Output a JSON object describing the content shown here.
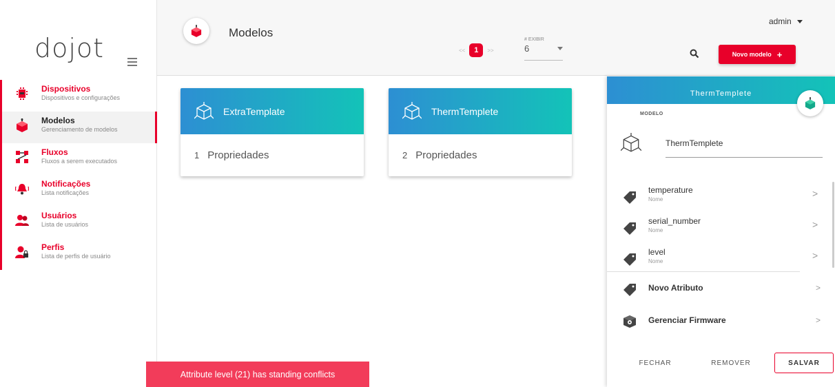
{
  "app": {
    "logo": "dojot"
  },
  "sidebar": {
    "items": [
      {
        "title": "Dispositivos",
        "subtitle": "Dispositivos e configurações",
        "icon": "chip-icon"
      },
      {
        "title": "Modelos",
        "subtitle": "Gerenciamento de modelos",
        "icon": "cube-icon"
      },
      {
        "title": "Fluxos",
        "subtitle": "Fluxos a serem executados",
        "icon": "flow-icon"
      },
      {
        "title": "Notificações",
        "subtitle": "Lista notificações",
        "icon": "bell-icon"
      },
      {
        "title": "Usuários",
        "subtitle": "Lista de usuários",
        "icon": "users-icon"
      },
      {
        "title": "Perfis",
        "subtitle": "Lista de perfis de usuário",
        "icon": "profile-lock-icon"
      }
    ]
  },
  "header": {
    "title": "Modelos",
    "pager": {
      "prev": "<<",
      "page": "1",
      "next": ">>"
    },
    "exibir_label": "# EXIBIR",
    "exibir_value": "6",
    "user": "admin",
    "new_button": "Novo modelo",
    "new_button_plus": "+"
  },
  "cards": [
    {
      "name": "ExtraTemplate",
      "count": "1",
      "label": "Propriedades"
    },
    {
      "name": "ThermTemplete",
      "count": "2",
      "label": "Propriedades"
    }
  ],
  "panel": {
    "title": "ThermTemplete",
    "section_label": "MODELO",
    "model_name": "ThermTemplete",
    "attributes": [
      {
        "name": "temperature",
        "type": "Nome"
      },
      {
        "name": "serial_number",
        "type": "Nome"
      },
      {
        "name": "level",
        "type": "Nome"
      }
    ],
    "actions": [
      {
        "label": "Novo Atributo"
      },
      {
        "label": "Gerenciar Firmware"
      }
    ],
    "buttons": {
      "close": "FECHAR",
      "remove": "REMOVER",
      "save": "SALVAR"
    },
    "chevron": ">"
  },
  "toast": {
    "message": "Attribute level (21) has standing conflicts"
  },
  "colors": {
    "accent": "#e8002a",
    "gradient_start": "#2d8fd3",
    "gradient_end": "#13c3b8",
    "toast": "#f23c5a"
  }
}
